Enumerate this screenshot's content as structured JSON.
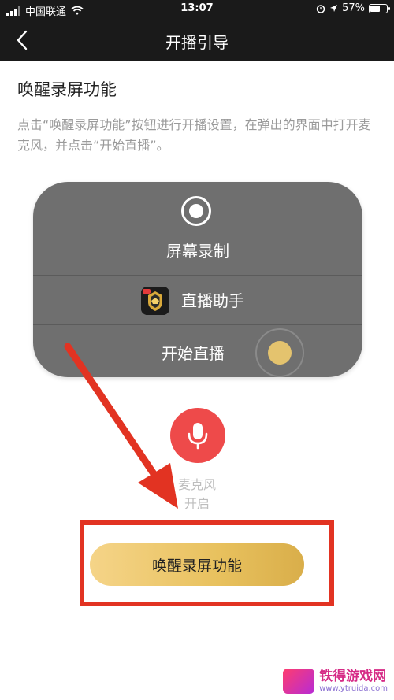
{
  "status_bar": {
    "carrier": "中国联通",
    "time": "13:07",
    "battery": "57%"
  },
  "nav": {
    "title": "开播引导"
  },
  "content": {
    "section_title": "唤醒录屏功能",
    "description": "点击“唤醒录屏功能”按钮进行开播设置，在弹出的界面中打开麦克风，并点击“开始直播”。"
  },
  "control_center": {
    "record_label": "屏幕录制",
    "app_label": "直播助手",
    "start_label": "开始直播"
  },
  "mic": {
    "label": "麦克风",
    "state": "开启"
  },
  "cta": {
    "label": "唤醒录屏功能"
  },
  "watermark": {
    "name": "铁得游戏网",
    "url": "www.ytruida.com"
  },
  "colors": {
    "nav_bg": "#1a1a1a",
    "card_bg": "#6f6f6f",
    "mic_red": "#ee4a4a",
    "highlight_red": "#e23322",
    "gold": "#e8c15e"
  }
}
